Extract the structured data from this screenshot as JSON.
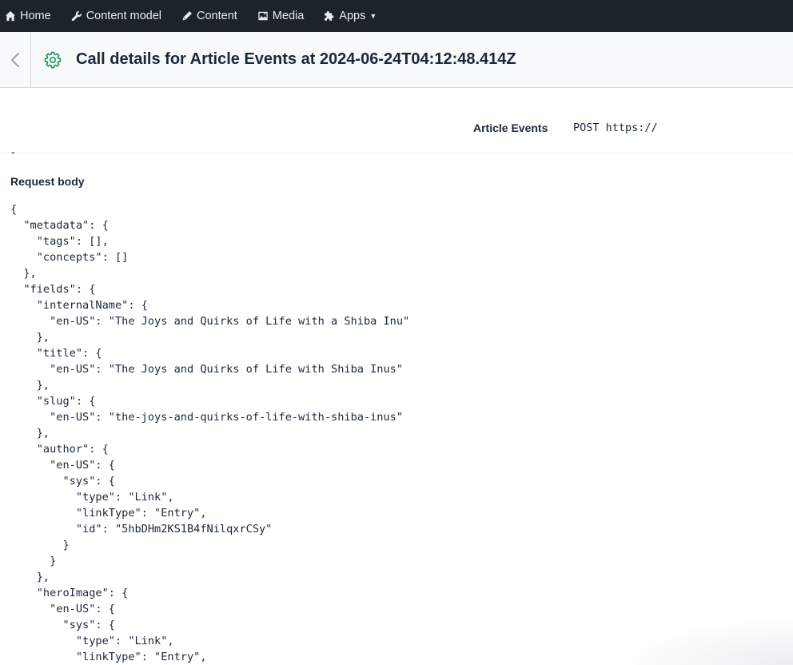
{
  "nav": {
    "items": [
      {
        "label": "Home",
        "icon": "home-icon"
      },
      {
        "label": "Content model",
        "icon": "wrench-icon"
      },
      {
        "label": "Content",
        "icon": "pen-icon"
      },
      {
        "label": "Media",
        "icon": "image-icon"
      },
      {
        "label": "Apps",
        "icon": "puzzle-icon"
      }
    ]
  },
  "header": {
    "title": "Call details for Article Events at 2024-06-24T04:12:48.414Z",
    "accent_color": "#1a8f52"
  },
  "summary": {
    "webhook_name": "Article Events",
    "request_line": "POST https://",
    "more": "⋮"
  },
  "body": {
    "stray_brace": "}",
    "section_label": "Request body",
    "code_lines": [
      "{",
      "  \"metadata\": {",
      "    \"tags\": [],",
      "    \"concepts\": []",
      "  },",
      "  \"fields\": {",
      "    \"internalName\": {",
      "      \"en-US\": \"The Joys and Quirks of Life with a Shiba Inu\"",
      "    },",
      "    \"title\": {",
      "      \"en-US\": \"The Joys and Quirks of Life with Shiba Inus\"",
      "    },",
      "    \"slug\": {",
      "      \"en-US\": \"the-joys-and-quirks-of-life-with-shiba-inus\"",
      "    },",
      "    \"author\": {",
      "      \"en-US\": {",
      "        \"sys\": {",
      "          \"type\": \"Link\",",
      "          \"linkType\": \"Entry\",",
      "          \"id\": \"5hbDHm2KS1B4fNilqxrCSy\"",
      "        }",
      "      }",
      "    },",
      "    \"heroImage\": {",
      "      \"en-US\": {",
      "        \"sys\": {",
      "          \"type\": \"Link\",",
      "          \"linkType\": \"Entry\","
    ]
  }
}
